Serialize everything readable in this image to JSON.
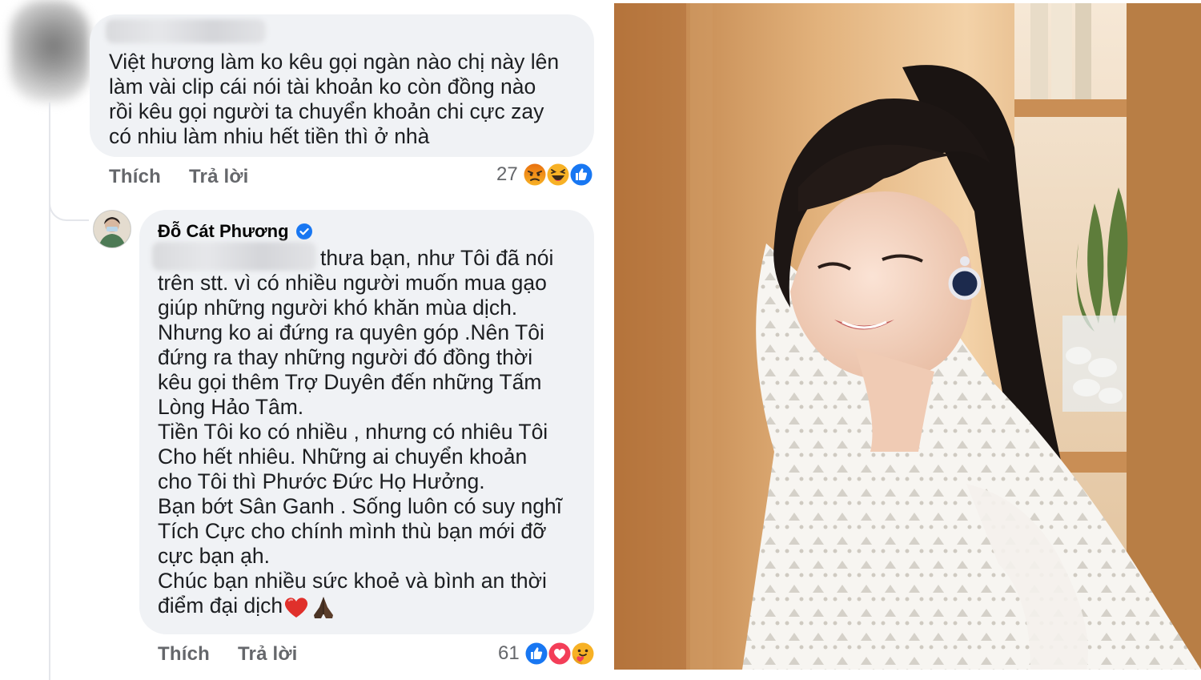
{
  "comment1": {
    "author_blurred": true,
    "text": "Việt hương làm ko kêu gọi ngàn nào chị này lên\nlàm vài clip cái nói tài khoản ko còn đồng nào\nrồi kêu gọi người ta chuyển khoản chi cực zay\ncó nhiu làm nhiu hết tiền thì ở nhà",
    "like_label": "Thích",
    "reply_label": "Trả lời",
    "reaction_count": "27",
    "reactions": [
      "angry-icon",
      "haha-icon",
      "like-icon"
    ]
  },
  "comment2": {
    "author": "Đỗ Cát Phương",
    "verified_icon": "verified-badge-icon",
    "tag_blurred": true,
    "text": "thưa bạn, như Tôi đã nói\ntrên stt. vì có nhiều người muốn mua gạo\ngiúp những người khó khăn mùa dịch.\nNhưng ko ai đứng ra quyên góp .Nên Tôi\nđứng ra thay những người đó đồng thời\nkêu gọi thêm Trợ Duyên đến những Tấm\nLòng Hảo Tâm.\nTiền Tôi ko có nhiều , nhưng có nhiêu Tôi\nCho hết nhiêu. Những ai chuyển khoản\ncho Tôi thì Phước Đức Họ Hưởng.\nBạn bớt Sân Ganh . Sống luôn có suy nghĩ\nTích Cực cho chính mình thù bạn mới đỡ\ncực bạn ạh.\nChúc bạn nhiều sức khoẻ và bình an thời\nđiểm đại dịch",
    "trailing_emojis": [
      "heart-emoji",
      "praying-hands-emoji"
    ],
    "like_label": "Thích",
    "reply_label": "Trả lời",
    "reaction_count": "61",
    "reactions": [
      "like-icon",
      "love-icon",
      "care-icon"
    ]
  },
  "colors": {
    "bubble": "#f0f2f5",
    "text": "#1c1e21",
    "secondary_text": "#65676b",
    "verified": "#1877f2",
    "like_blue": "#1877f2",
    "love_red": "#f33e58",
    "reaction_yellow": "#f7b125"
  },
  "photo": {
    "subject": "portrait-photo"
  }
}
